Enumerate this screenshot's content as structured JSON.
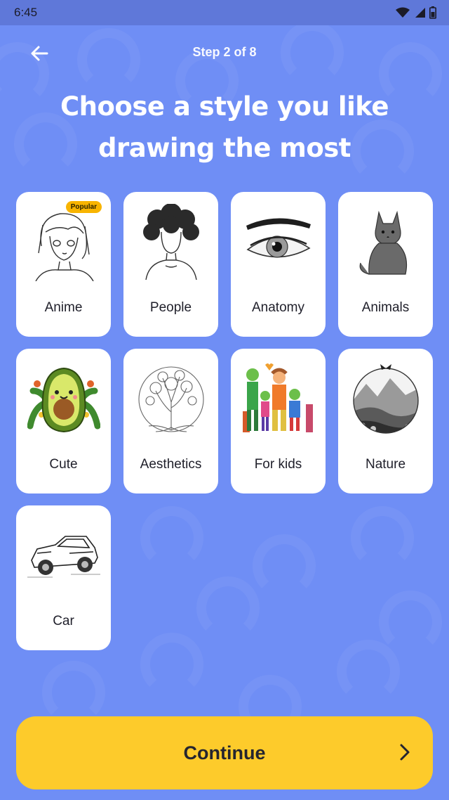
{
  "status_bar": {
    "time": "6:45",
    "icons": [
      "wifi-icon",
      "signal-icon",
      "battery-icon"
    ]
  },
  "header": {
    "back_icon": "arrow-left-icon",
    "step": "Step 2 of 8"
  },
  "title": {
    "line1": "Choose a style you like",
    "line2": "drawing the most"
  },
  "styles": [
    {
      "label": "Anime",
      "badge": "Popular",
      "art": "anime-girl-sketch"
    },
    {
      "label": "People",
      "art": "curly-hair-woman-sketch"
    },
    {
      "label": "Anatomy",
      "art": "eye-sketch"
    },
    {
      "label": "Animals",
      "art": "cat-sketch"
    },
    {
      "label": "Cute",
      "art": "avocado-illustration"
    },
    {
      "label": "Aesthetics",
      "art": "tree-of-life-sketch"
    },
    {
      "label": "For kids",
      "art": "family-crayon-drawing"
    },
    {
      "label": "Nature",
      "art": "landscape-circle-sketch"
    },
    {
      "label": "Car",
      "art": "car-sketch"
    }
  ],
  "continue_button": {
    "label": "Continue",
    "icon": "chevron-right-icon"
  },
  "colors": {
    "background": "#6f8ef5",
    "status_bar": "#5f78d9",
    "card": "#ffffff",
    "badge": "#f8b400",
    "button": "#fdcb2b"
  }
}
